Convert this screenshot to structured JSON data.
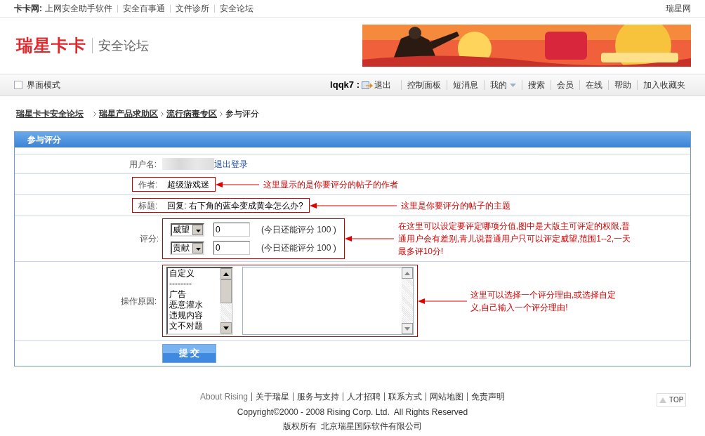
{
  "top_bar": {
    "site_label": "卡卡网:",
    "links": [
      "上网安全助手软件",
      "安全百事通",
      "文件诊所",
      "安全论坛"
    ],
    "right_link": "瑞星网"
  },
  "header": {
    "logo": "瑞星卡卡",
    "subtitle": "安全论坛"
  },
  "nav": {
    "mode_toggle": {
      "label": "界面模式",
      "checked": false
    },
    "username": "lqqk7 :",
    "logout": "退出",
    "items": [
      {
        "label": "控制面板",
        "kind": "link"
      },
      {
        "label": "短消息",
        "kind": "link"
      },
      {
        "label": "我的",
        "kind": "dropdown"
      },
      {
        "label": "搜索",
        "kind": "link"
      },
      {
        "label": "会员",
        "kind": "link"
      },
      {
        "label": "在线",
        "kind": "link"
      },
      {
        "label": "帮助",
        "kind": "link"
      },
      {
        "label": "加入收藏夹",
        "kind": "link"
      }
    ]
  },
  "breadcrumb": [
    {
      "label": "瑞星卡卡安全论坛",
      "kind": "link"
    },
    {
      "label": "瑞星产品求助区",
      "kind": "link"
    },
    {
      "label": "流行病毒专区",
      "kind": "link"
    },
    {
      "label": "参与评分",
      "kind": "current"
    }
  ],
  "form": {
    "title": "参与评分",
    "rows": [
      {
        "kind": "user",
        "label": "用户名:",
        "link": "退出登录"
      },
      {
        "kind": "framed_text",
        "label": "作者:",
        "value": "超级游戏迷",
        "annotation": "这里显示的是你要评分的帖子的作者"
      },
      {
        "kind": "framed_text",
        "label": "标题:",
        "value": "回复: 右下角的蓝伞变成黄伞怎么办?",
        "annotation": "这里是你要评分的帖子的主题"
      },
      {
        "kind": "scores",
        "label": "评分:",
        "scores": [
          {
            "type": "威望",
            "value": "0",
            "note": "(今日还能评分 100 )"
          },
          {
            "type": "贡献",
            "value": "0",
            "note": "(今日还能评分 100 )"
          }
        ],
        "annotation": "在这里可以设定要评定哪项分值,图中是大版主可评定的权限,普通用户会有差别,青儿说普通用户只可以评定威望,范围1--2,一天最多评10分!"
      },
      {
        "kind": "reason",
        "label": "操作原因:",
        "options": [
          "自定义",
          "--------",
          "广告",
          "恶意灌水",
          "违规内容",
          "文不对题"
        ],
        "annotation": "这里可以选择一个评分理由,或选择自定义,自己输入一个评分理由!"
      }
    ],
    "submit": "提 交"
  },
  "footer": {
    "links": [
      "About Rising",
      "关于瑞星",
      "服务与支持",
      "人才招聘",
      "联系方式",
      "网站地图",
      "免责声明"
    ],
    "copyright": "Copyright©2000 - 2008 Rising Corp. Ltd.  All Rights Reserved",
    "company": "版权所有  北京瑞星国际软件有限公司",
    "top_button": "TOP"
  }
}
